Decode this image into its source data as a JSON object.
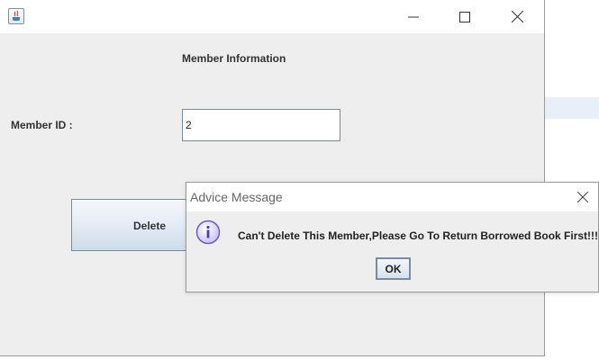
{
  "window": {
    "title": "",
    "header": "Member Information",
    "member_id_label": "Member ID :",
    "member_id_value": "2",
    "delete_label": "Delete",
    "controls": {
      "minimize": "minimize-icon",
      "maximize": "maximize-icon",
      "close": "close-icon"
    }
  },
  "dialog": {
    "title": "Advice Message",
    "message": "Can't Delete This Member,Please Go To Return Borrowed Book First!!!",
    "ok_label": "OK",
    "icon": "info-icon"
  },
  "colors": {
    "window_bg": "#eeeeee",
    "button_gradient_bottom": "#cfdcea",
    "info_icon": "#6a5acd"
  }
}
